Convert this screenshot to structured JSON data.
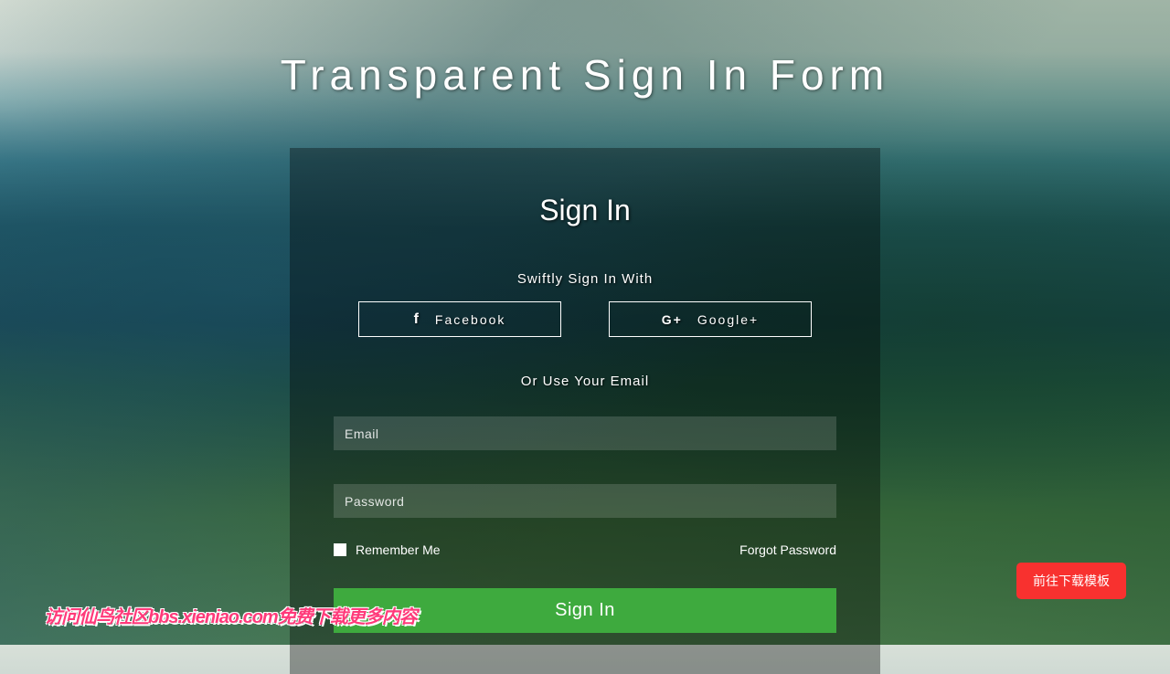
{
  "page": {
    "title": "Transparent Sign In Form"
  },
  "form": {
    "title": "Sign In",
    "swift_label": "Swiftly Sign In With",
    "facebook_label": "Facebook",
    "google_label": "Google+",
    "divider_label": "Or Use Your Email",
    "email_placeholder": "Email",
    "password_placeholder": "Password",
    "remember_label": "Remember Me",
    "forgot_label": "Forgot Password",
    "submit_label": "Sign In"
  },
  "watermark": {
    "text": "访问仙鸟社区bbs.xieniao.com免费下载更多内容"
  },
  "download_button": {
    "label": "前往下载模板"
  }
}
